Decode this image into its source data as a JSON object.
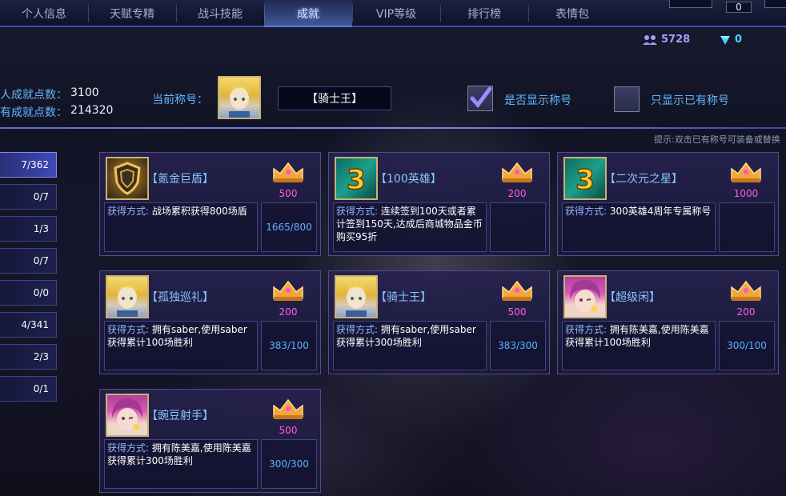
{
  "tabs": [
    {
      "label": "个人信息",
      "active": false
    },
    {
      "label": "天赋专精",
      "active": false
    },
    {
      "label": "战斗技能",
      "active": false
    },
    {
      "label": "成就",
      "active": true
    },
    {
      "label": "VIP等级",
      "active": false
    },
    {
      "label": "排行榜",
      "active": false
    },
    {
      "label": "表情包",
      "active": false
    }
  ],
  "top_right": {
    "count": "0"
  },
  "currency": {
    "friends": "5728",
    "diamond": "0"
  },
  "stats": {
    "personal_label": "人成就点数：",
    "personal_value": "3100",
    "total_label": "有成就点数：",
    "total_value": "214320"
  },
  "current_title": {
    "label": "当前称号：",
    "value": "【骑士王】"
  },
  "options": {
    "show_title_label": "是否显示称号",
    "show_title_checked": true,
    "only_owned_label": "只显示已有称号",
    "only_owned_checked": false
  },
  "hint": "提示:双击已有称号可装备或替换",
  "sidebar": [
    {
      "count": "7/362",
      "active": true
    },
    {
      "count": "0/7",
      "active": false
    },
    {
      "count": "1/3",
      "active": false
    },
    {
      "count": "0/7",
      "active": false
    },
    {
      "count": "0/0",
      "active": false
    },
    {
      "count": "4/341",
      "active": false
    },
    {
      "count": "2/3",
      "active": false
    },
    {
      "count": "0/1",
      "active": false
    }
  ],
  "cards": [
    {
      "icon": "shield-icon",
      "name": "【氪金巨盾】",
      "points": "500",
      "method_label": "获得方式:",
      "method": "战场累积获得800场盾",
      "progress": "1665/800"
    },
    {
      "icon": "three-icon",
      "name": "【100英雄】",
      "points": "200",
      "method_label": "获得方式:",
      "method": "连续签到100天或者累计签到150天,达成后商城物品金币购买95折",
      "progress": ""
    },
    {
      "icon": "three-icon",
      "name": "【二次元之星】",
      "points": "1000",
      "method_label": "获得方式:",
      "method": "300英雄4周年专属称号",
      "progress": ""
    },
    {
      "icon": "saber-avatar-icon",
      "name": "【孤独巡礼】",
      "points": "200",
      "method_label": "获得方式:",
      "method": "拥有saber,使用saber获得累计100场胜利",
      "progress": "383/100"
    },
    {
      "icon": "saber-avatar-icon",
      "name": "【骑士王】",
      "points": "500",
      "method_label": "获得方式:",
      "method": "拥有saber,使用saber获得累计300场胜利",
      "progress": "383/300"
    },
    {
      "icon": "girl-avatar-icon",
      "name": "【超级闲】",
      "points": "200",
      "method_label": "获得方式:",
      "method": "拥有陈美嘉,使用陈美嘉获得累计100场胜利",
      "progress": "300/100"
    },
    {
      "icon": "girl-avatar-icon",
      "name": "【豌豆射手】",
      "points": "500",
      "method_label": "获得方式:",
      "method": "拥有陈美嘉,使用陈美嘉获得累计300场胜利",
      "progress": "300/300"
    }
  ],
  "colors": {
    "accent": "#62b5ff",
    "points": "#ff5fe6",
    "progress": "#58b4ff",
    "active_tab": "#6e96ff"
  }
}
